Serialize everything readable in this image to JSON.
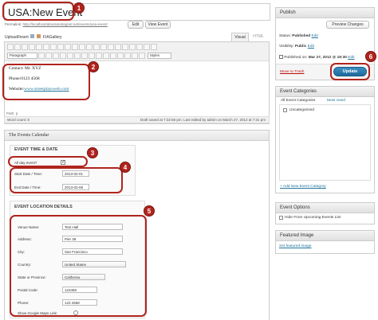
{
  "title_input": {
    "value": "USA:New Event"
  },
  "permalink": {
    "label": "Permalink:",
    "url": "http://localhost/absolutestagnet.net/events/usa-event/",
    "edit_label": "Edit",
    "view_label": "View Event"
  },
  "media": {
    "upload_label": "Upload/Insert",
    "gallery_label": "FIAGallery"
  },
  "editor_tabs": {
    "visual": "Visual",
    "html": "HTML"
  },
  "toolbar": {
    "format_select": "Paragraph",
    "styles_select": "Styles"
  },
  "content": {
    "contact": "Contact: Mr. XYZ",
    "phone": "Phone:0123 4568",
    "website_label": "Website:",
    "website_link": "www.streetplaysweb.com"
  },
  "status_bar": {
    "path": "Path: p",
    "word_count": "Word count: 8",
    "saved_text": "Draft saved at 7:32:56 pm. Last edited by admin on March 27, 2012 at 7:31 pm"
  },
  "calendar_box": {
    "title": "The Events Calendar"
  },
  "event_time": {
    "heading": "EVENT TIME & DATE",
    "all_day_label": "All day event?",
    "start_label": "Start Date / Time:",
    "start_value": "2013-02-01",
    "end_label": "End Date / Time:",
    "end_value": "2013-02-08"
  },
  "event_location": {
    "heading": "EVENT LOCATION DETAILS",
    "venue_label": "Venue Name:",
    "venue_value": "Test Hall",
    "address_label": "Address:",
    "address_value": "Pier 39",
    "city_label": "City:",
    "city_value": "San Francisco",
    "country_label": "Country:",
    "country_value": "United States",
    "state_label": "State or Province:",
    "state_value": "California",
    "postal_label": "Postal Code:",
    "postal_value": "123456",
    "phone_label": "Phone:",
    "phone_value": "123 4568",
    "map_label": "Show Google Maps Link:"
  },
  "publish": {
    "title": "Publish",
    "preview_label": "Preview Changes",
    "status_label": "Status:",
    "status_value": "Published",
    "status_edit": "Edit",
    "visibility_label": "Visibility:",
    "visibility_value": "Public",
    "visibility_edit": "Edit",
    "published_label": "Published on:",
    "published_value": "Mar 27, 2012 @ 19:30",
    "published_edit": "Edit",
    "trash_label": "Move to Trash",
    "update_label": "Update"
  },
  "categories": {
    "title": "Event Categories",
    "tab_all": "All Event Categories",
    "tab_used": "Most Used",
    "item": "Uncategorized",
    "add_link": "+ Add New Event Category"
  },
  "options": {
    "title": "Event Options",
    "hide_label": "Hide From Upcoming Events List"
  },
  "featured": {
    "title": "Featured Image",
    "set_link": "Set featured image"
  },
  "badges": [
    "1",
    "2",
    "3",
    "4",
    "5",
    "6"
  ]
}
